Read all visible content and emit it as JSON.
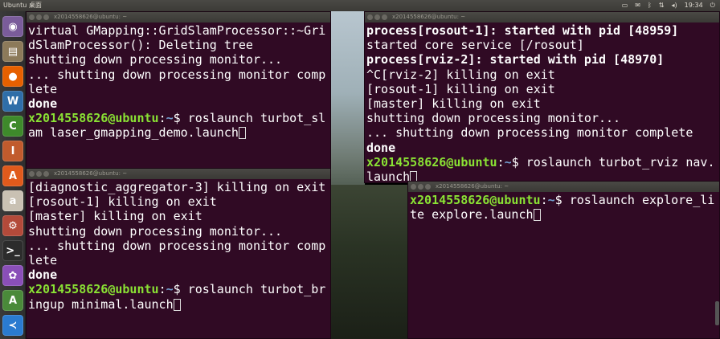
{
  "top_panel": {
    "title": "Ubuntu 桌面",
    "time": "19:34",
    "tray_icons": [
      "keyboard-icon",
      "mail-icon",
      "bluetooth-icon",
      "wifi-icon",
      "volume-icon",
      "power-icon"
    ]
  },
  "launcher": {
    "items": [
      {
        "name": "dash-home",
        "glyph": "◉",
        "color": "#7a5c9a"
      },
      {
        "name": "files",
        "glyph": "▤",
        "color": "#8c7a5a"
      },
      {
        "name": "firefox",
        "glyph": "●",
        "color": "#e66000"
      },
      {
        "name": "libreoffice-writer",
        "glyph": "W",
        "color": "#2f6ea8"
      },
      {
        "name": "libreoffice-calc",
        "glyph": "C",
        "color": "#3e8a2b"
      },
      {
        "name": "libreoffice-impress",
        "glyph": "I",
        "color": "#c15b2d"
      },
      {
        "name": "ubuntu-software",
        "glyph": "A",
        "color": "#e05a1c"
      },
      {
        "name": "amazon",
        "glyph": "a",
        "color": "#c9c1b3"
      },
      {
        "name": "system-settings",
        "glyph": "⚙",
        "color": "#b34a3a"
      },
      {
        "name": "terminal",
        "glyph": ">_",
        "color": "#2c2c2c"
      },
      {
        "name": "app-purple",
        "glyph": "✿",
        "color": "#8a4fb8"
      },
      {
        "name": "qtcreator",
        "glyph": "A",
        "color": "#4a8a3a"
      },
      {
        "name": "vscode",
        "glyph": "≺",
        "color": "#2a7bd0"
      }
    ]
  },
  "terminals": {
    "top_left": {
      "title": "x2014558626@ubuntu: ~",
      "lines": [
        {
          "text": "virtual GMapping::GridSlamProcessor::~GridSlamProcessor(): Deleting tree",
          "style": ""
        },
        {
          "text": "shutting down processing monitor...",
          "style": ""
        },
        {
          "text": "... shutting down processing monitor complete",
          "style": ""
        },
        {
          "text": "done",
          "style": "b"
        }
      ],
      "prompt_user": "x2014558626@ubuntu",
      "prompt_path": "~",
      "command": "roslaunch turbot_slam laser_gmapping_demo.launch"
    },
    "bottom_left": {
      "title": "x2014558626@ubuntu: ~",
      "lines": [
        {
          "text": "[diagnostic_aggregator-3] killing on exit",
          "style": ""
        },
        {
          "text": "[rosout-1] killing on exit",
          "style": ""
        },
        {
          "text": "[master] killing on exit",
          "style": ""
        },
        {
          "text": "shutting down processing monitor...",
          "style": ""
        },
        {
          "text": "... shutting down processing monitor complete",
          "style": ""
        },
        {
          "text": "done",
          "style": "b"
        }
      ],
      "prompt_user": "x2014558626@ubuntu",
      "prompt_path": "~",
      "command": "roslaunch turbot_bringup minimal.launch"
    },
    "top_right": {
      "title": "x2014558626@ubuntu: ~",
      "lines": [
        {
          "text": "process[rosout-1]: started with pid [48959]",
          "style": "b"
        },
        {
          "text": "started core service [/rosout]",
          "style": ""
        },
        {
          "text": "process[rviz-2]: started with pid [48970]",
          "style": "b"
        },
        {
          "text": "^C[rviz-2] killing on exit",
          "style": ""
        },
        {
          "text": "[rosout-1] killing on exit",
          "style": ""
        },
        {
          "text": "[master] killing on exit",
          "style": ""
        },
        {
          "text": "shutting down processing monitor...",
          "style": ""
        },
        {
          "text": "... shutting down processing monitor complete",
          "style": ""
        },
        {
          "text": "done",
          "style": "b"
        }
      ],
      "prompt_user": "x2014558626@ubuntu",
      "prompt_path": "~",
      "command": "roslaunch turbot_rviz nav.launch"
    },
    "bottom_right": {
      "title": "x2014558626@ubuntu: ~",
      "lines": [],
      "prompt_user": "x2014558626@ubuntu",
      "prompt_path": "~",
      "command": "roslaunch explore_lite explore.launch"
    }
  }
}
